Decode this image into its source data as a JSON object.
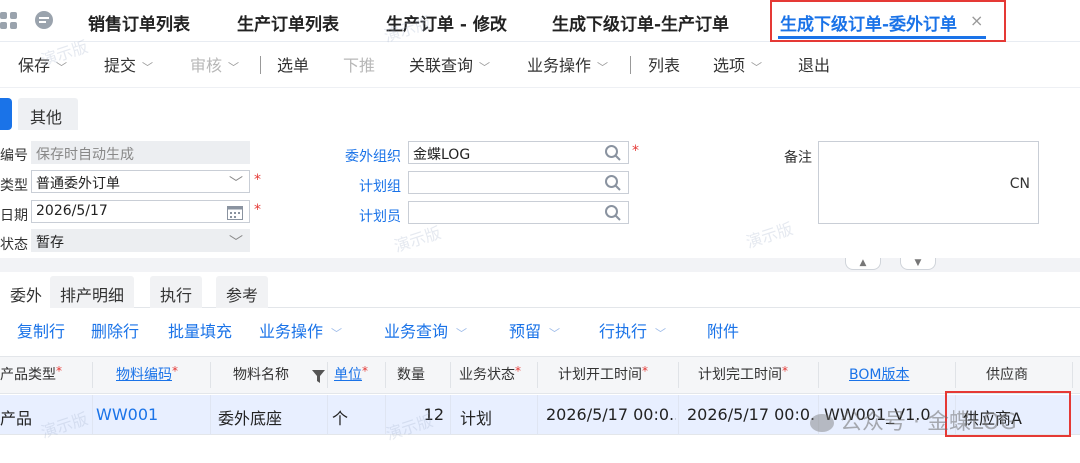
{
  "tabs": [
    {
      "label": "销售订单列表"
    },
    {
      "label": "生产订单列表"
    },
    {
      "label": "生产订单 - 修改"
    },
    {
      "label": "生成下级订单-生产订单"
    },
    {
      "label": "生成下级订单-委外订单",
      "active": true
    }
  ],
  "toolbar": {
    "save": "保存",
    "submit": "提交",
    "audit": "审核",
    "select": "选单",
    "push_down": "下推",
    "related_query": "关联查询",
    "business_ops": "业务操作",
    "list": "列表",
    "options": "选项",
    "exit": "退出"
  },
  "subtab": "其他",
  "form": {
    "number_label": "编号",
    "number_placeholder": "保存时自动生成",
    "type_label": "类型",
    "type_value": "普通委外订单",
    "date_label": "日期",
    "date_value": "2026/5/17",
    "status_label": "状态",
    "status_value": "暂存",
    "org_label": "委外组织",
    "org_value": "金蝶LOG",
    "plan_group_label": "计划组",
    "planner_label": "计划员",
    "remark_label": "备注",
    "remark_value": "CN"
  },
  "entry_tabs": [
    "委外",
    "排产明细",
    "执行",
    "参考"
  ],
  "entry_toolbar": {
    "copy_row": "复制行",
    "delete_row": "删除行",
    "batch_fill": "批量填充",
    "business_ops": "业务操作",
    "business_query": "业务查询",
    "reserve": "预留",
    "row_execute": "行执行",
    "attachment": "附件"
  },
  "grid": {
    "headers": {
      "product_type": "产品类型",
      "material_code": "物料编码",
      "material_name": "物料名称",
      "unit": "单位",
      "quantity": "数量",
      "biz_status": "业务状态",
      "plan_start": "计划开工时间",
      "plan_finish": "计划完工时间",
      "bom_version": "BOM版本",
      "supplier": "供应商"
    },
    "rows": [
      {
        "product_type": "产品",
        "material_code": "WW001",
        "material_name": "委外底座",
        "unit": "个",
        "quantity": "12",
        "biz_status": "计划",
        "plan_start": "2026/5/17 00:0...",
        "plan_finish": "2026/5/17 00:0...",
        "bom_version": "WW001_V1.0",
        "supplier": "供应商A"
      }
    ]
  },
  "watermark": {
    "demo": "演示版",
    "logo": "公众号 · 金蝶LOG"
  },
  "colors": {
    "accent": "#1a73e8",
    "highlight": "#e53935"
  }
}
